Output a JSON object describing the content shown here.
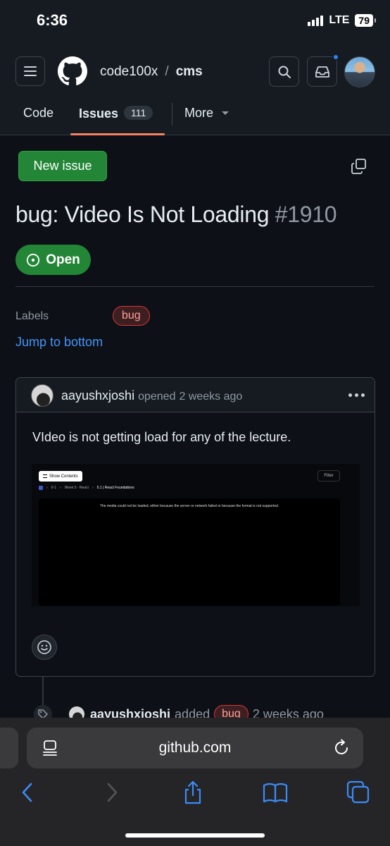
{
  "status_bar": {
    "time": "6:36",
    "network": "LTE",
    "battery": "79"
  },
  "header": {
    "owner": "code100x",
    "separator": "/",
    "repo": "cms",
    "tabs": [
      {
        "label": "Code"
      },
      {
        "label": "Issues",
        "count": "111",
        "selected": true
      },
      {
        "label": "More"
      }
    ]
  },
  "issue": {
    "new_issue_label": "New issue",
    "title": "bug: Video Is Not Loading",
    "number": "#1910",
    "state": "Open",
    "labels_key": "Labels",
    "labels": [
      "bug"
    ],
    "jump_link": "Jump to bottom"
  },
  "comment": {
    "author": "aayushxjoshi",
    "action": "opened",
    "time": "2 weeks ago",
    "body": "VIdeo is not getting load for any of the lecture.",
    "screenshot": {
      "show_contents": "Show Contents",
      "filter": "Filter",
      "crumbs": [
        "0-1",
        "Week 5 - React",
        "5.1 | React Foundations"
      ],
      "message": "The media could not be loaded, either because the server or network failed or because the format is not supported."
    }
  },
  "event": {
    "actor": "aayushxjoshi",
    "action": "added",
    "label": "bug",
    "time": "2 weeks ago"
  },
  "browser": {
    "url": "github.com"
  },
  "colors": {
    "accent_green": "#238636",
    "link_blue": "#4493f8",
    "tab_underline": "#f78166",
    "bug_label": "#da3633"
  }
}
